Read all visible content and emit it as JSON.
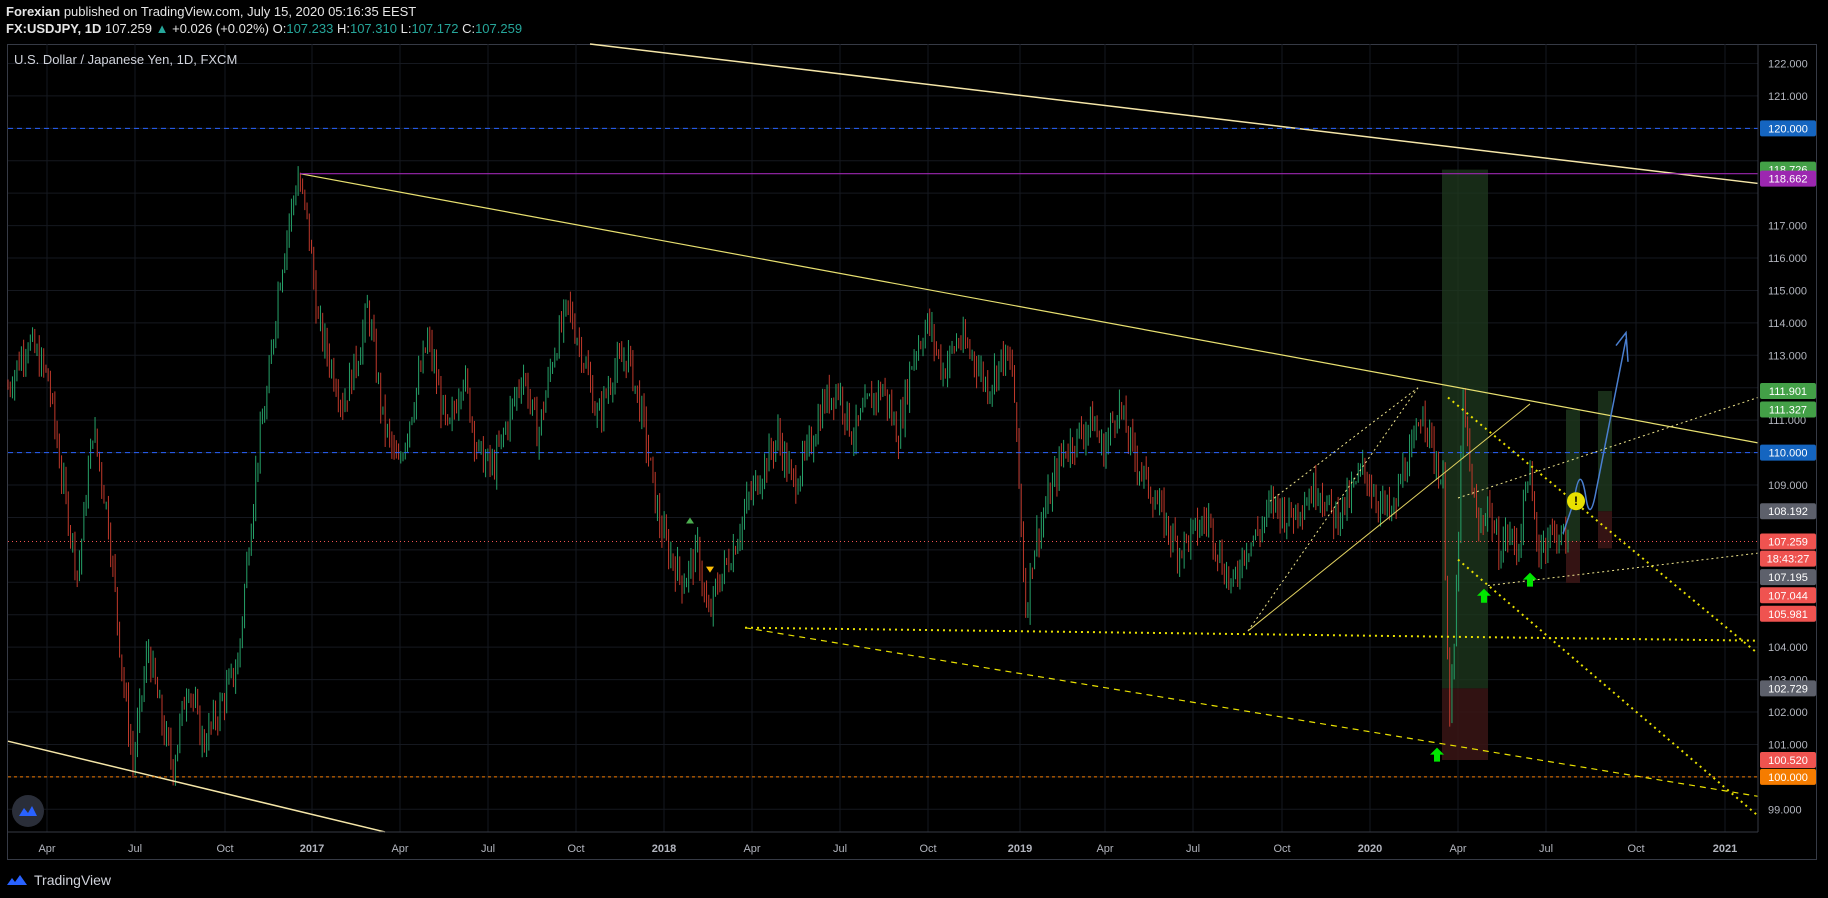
{
  "header": {
    "author": "Forexian",
    "published": "published on TradingView.com, July 15, 2020 05:16:35 EEST"
  },
  "quote": {
    "symbol": "FX:USDJPY, 1D",
    "last": "107.259",
    "change": "+0.026 (+0.02%)",
    "o_label": "O:",
    "open": "107.233",
    "h_label": "H:",
    "high": "107.310",
    "l_label": "L:",
    "low": "107.172",
    "c_label": "C:",
    "close": "107.259",
    "up_color": "#26a69a"
  },
  "chart_title": "U.S. Dollar / Japanese Yen, 1D, FXCM",
  "footer": {
    "brand": "TradingView"
  },
  "colors": {
    "background": "#000000",
    "candle_up": "#26a269",
    "candle_down": "#c0392b",
    "trendline_yellow": "#f0e68c",
    "purple": "#9c27b0",
    "blue_dash": "#2962ff",
    "projection_blue": "#4a7fd0"
  },
  "chart_data": {
    "type": "candlestick",
    "title": "U.S. Dollar / Japanese Yen, 1D, FXCM",
    "ylim": [
      98.3,
      122.6
    ],
    "y_ticks": [
      "99.000",
      "101.000",
      "102.000",
      "103.000",
      "104.000",
      "109.000",
      "111.000",
      "112.000",
      "113.000",
      "114.000",
      "115.000",
      "116.000",
      "117.000",
      "121.000",
      "122.000"
    ],
    "x_ticks": [
      "Apr",
      "Jul",
      "Oct",
      "2017",
      "Apr",
      "Jul",
      "Oct",
      "2018",
      "Apr",
      "Jul",
      "Oct",
      "2019",
      "Apr",
      "Jul",
      "Oct",
      "2020",
      "Apr",
      "Jul",
      "Oct",
      "2021"
    ],
    "price_labels": [
      {
        "text": "120.000",
        "value": 120.0,
        "color": "#1565c0"
      },
      {
        "text": "118.726",
        "value": 118.726,
        "color": "#43a047"
      },
      {
        "text": "118.662",
        "value": 118.45,
        "color": "#9c27b0"
      },
      {
        "text": "111.901",
        "value": 111.901,
        "color": "#43a047"
      },
      {
        "text": "111.327",
        "value": 111.327,
        "color": "#43a047"
      },
      {
        "text": "110.000",
        "value": 110.0,
        "color": "#1565c0"
      },
      {
        "text": "108.192",
        "value": 108.192,
        "color": "#5d606b"
      },
      {
        "text": "107.259",
        "value": 107.259,
        "color": "#ef5350"
      },
      {
        "text": "18:43:27",
        "value": 106.73,
        "color": "#ef5350"
      },
      {
        "text": "107.195",
        "value": 106.16,
        "color": "#5d606b"
      },
      {
        "text": "107.044",
        "value": 105.6,
        "color": "#ef5350"
      },
      {
        "text": "105.981",
        "value": 105.03,
        "color": "#ef5350"
      },
      {
        "text": "102.729",
        "value": 102.729,
        "color": "#5d606b"
      },
      {
        "text": "100.520",
        "value": 100.52,
        "color": "#ef5350"
      },
      {
        "text": "100.000",
        "value": 100.0,
        "color": "#f57c00"
      }
    ],
    "close_path": [
      [
        0,
        112.0
      ],
      [
        20,
        113.5
      ],
      [
        40,
        112.3
      ],
      [
        55,
        109.0
      ],
      [
        70,
        106.2
      ],
      [
        85,
        110.8
      ],
      [
        100,
        108.0
      ],
      [
        115,
        103.0
      ],
      [
        125,
        100.4
      ],
      [
        140,
        104.0
      ],
      [
        155,
        101.5
      ],
      [
        165,
        100.3
      ],
      [
        180,
        103.0
      ],
      [
        195,
        101.0
      ],
      [
        210,
        102.0
      ],
      [
        230,
        103.5
      ],
      [
        240,
        107.0
      ],
      [
        250,
        110.0
      ],
      [
        260,
        112.0
      ],
      [
        270,
        115.0
      ],
      [
        280,
        117.0
      ],
      [
        290,
        118.5
      ],
      [
        300,
        117.0
      ],
      [
        310,
        114.0
      ],
      [
        320,
        113.0
      ],
      [
        335,
        111.5
      ],
      [
        350,
        113.0
      ],
      [
        360,
        114.5
      ],
      [
        375,
        111.0
      ],
      [
        390,
        109.5
      ],
      [
        405,
        111.5
      ],
      [
        420,
        113.5
      ],
      [
        440,
        110.5
      ],
      [
        455,
        112.5
      ],
      [
        470,
        110.0
      ],
      [
        485,
        109.5
      ],
      [
        500,
        111.0
      ],
      [
        515,
        112.5
      ],
      [
        530,
        110.5
      ],
      [
        545,
        113.0
      ],
      [
        560,
        114.5
      ],
      [
        575,
        113.0
      ],
      [
        590,
        111.0
      ],
      [
        605,
        112.5
      ],
      [
        620,
        113.0
      ],
      [
        635,
        111.0
      ],
      [
        650,
        108.0
      ],
      [
        660,
        107.0
      ],
      [
        675,
        106.0
      ],
      [
        690,
        107.0
      ],
      [
        700,
        104.8
      ],
      [
        710,
        106.0
      ],
      [
        725,
        107.0
      ],
      [
        740,
        108.5
      ],
      [
        755,
        109.5
      ],
      [
        770,
        110.5
      ],
      [
        785,
        109.0
      ],
      [
        800,
        110.0
      ],
      [
        815,
        111.5
      ],
      [
        830,
        112.0
      ],
      [
        845,
        110.5
      ],
      [
        860,
        111.5
      ],
      [
        875,
        112.0
      ],
      [
        890,
        110.5
      ],
      [
        905,
        113.0
      ],
      [
        920,
        114.0
      ],
      [
        935,
        112.5
      ],
      [
        950,
        113.5
      ],
      [
        965,
        113.0
      ],
      [
        980,
        112.0
      ],
      [
        995,
        113.0
      ],
      [
        1005,
        112.5
      ],
      [
        1010,
        109.5
      ],
      [
        1018,
        105.0
      ],
      [
        1025,
        107.0
      ],
      [
        1040,
        108.5
      ],
      [
        1055,
        110.0
      ],
      [
        1070,
        110.5
      ],
      [
        1085,
        111.0
      ],
      [
        1095,
        110.0
      ],
      [
        1110,
        111.5
      ],
      [
        1125,
        110.0
      ],
      [
        1140,
        109.0
      ],
      [
        1155,
        108.0
      ],
      [
        1170,
        107.0
      ],
      [
        1185,
        107.5
      ],
      [
        1200,
        108.0
      ],
      [
        1215,
        106.5
      ],
      [
        1225,
        105.8
      ],
      [
        1235,
        107.0
      ],
      [
        1250,
        107.5
      ],
      [
        1265,
        108.5
      ],
      [
        1280,
        108.0
      ],
      [
        1295,
        108.5
      ],
      [
        1310,
        109.0
      ],
      [
        1325,
        108.0
      ],
      [
        1340,
        108.5
      ],
      [
        1355,
        109.5
      ],
      [
        1370,
        108.5
      ],
      [
        1385,
        108.0
      ],
      [
        1395,
        109.5
      ],
      [
        1405,
        110.0
      ],
      [
        1415,
        111.5
      ],
      [
        1425,
        110.0
      ],
      [
        1435,
        109.0
      ],
      [
        1442,
        101.5
      ],
      [
        1447,
        104.5
      ],
      [
        1455,
        111.5
      ],
      [
        1462,
        109.5
      ],
      [
        1470,
        107.5
      ],
      [
        1480,
        108.5
      ],
      [
        1490,
        107.0
      ],
      [
        1500,
        107.5
      ],
      [
        1510,
        107.0
      ],
      [
        1520,
        109.5
      ],
      [
        1530,
        107.0
      ],
      [
        1540,
        107.5
      ],
      [
        1550,
        107.5
      ],
      [
        1560,
        107.26
      ]
    ]
  }
}
